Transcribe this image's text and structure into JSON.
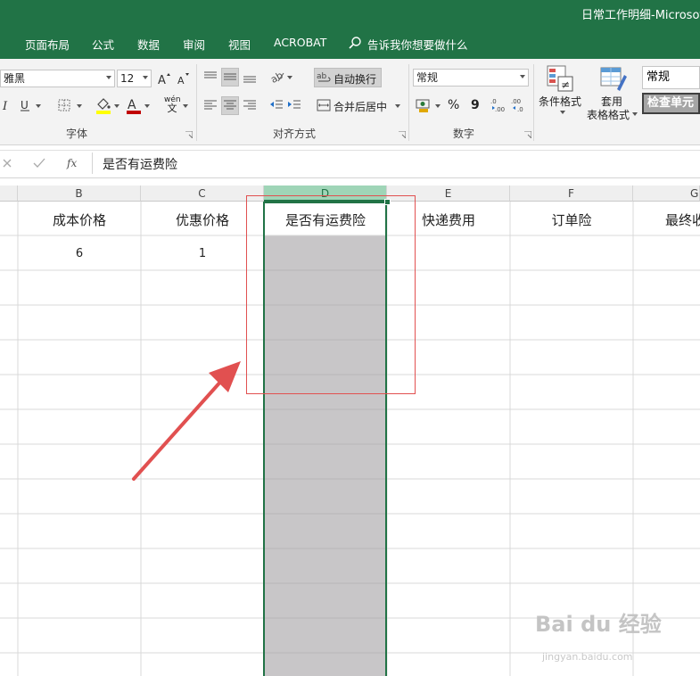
{
  "window": {
    "title": "日常工作明细-Microsoft"
  },
  "menu": {
    "tabs": [
      "页面布局",
      "公式",
      "数据",
      "审阅",
      "视图",
      "ACROBAT"
    ],
    "search_text": "告诉我你想要做什么"
  },
  "ribbon": {
    "font_name": "雅黑",
    "font_size": "12",
    "wen_label": "wén",
    "wen_char": "文",
    "wrap_text": "自动换行",
    "merge_center": "合并后居中",
    "number_format": "常规",
    "percent": "%",
    "comma": "9",
    "conditional_format": "条件格式",
    "table_format_line1": "套用",
    "table_format_line2": "表格格式",
    "style_normal": "常规",
    "style_check": "检查单元",
    "group_labels": {
      "font": "字体",
      "alignment": "对齐方式",
      "number": "数字"
    }
  },
  "formula_bar": {
    "fx": "fx",
    "content": "是否有运费险"
  },
  "columns": [
    "B",
    "C",
    "D",
    "E",
    "F",
    "G"
  ],
  "header_row": [
    "成本价格",
    "优惠价格",
    "是否有运费险",
    "快递费用",
    "订单险",
    "最终收"
  ],
  "data_row": [
    "6",
    "1",
    "",
    "",
    "",
    ""
  ],
  "watermark": {
    "brand": "Bai du 经验",
    "url": "jingyan.baidu.com"
  },
  "colors": {
    "excel_green": "#217346",
    "selection_fill": "#c8c6c8",
    "annotation_red": "#e15050"
  }
}
